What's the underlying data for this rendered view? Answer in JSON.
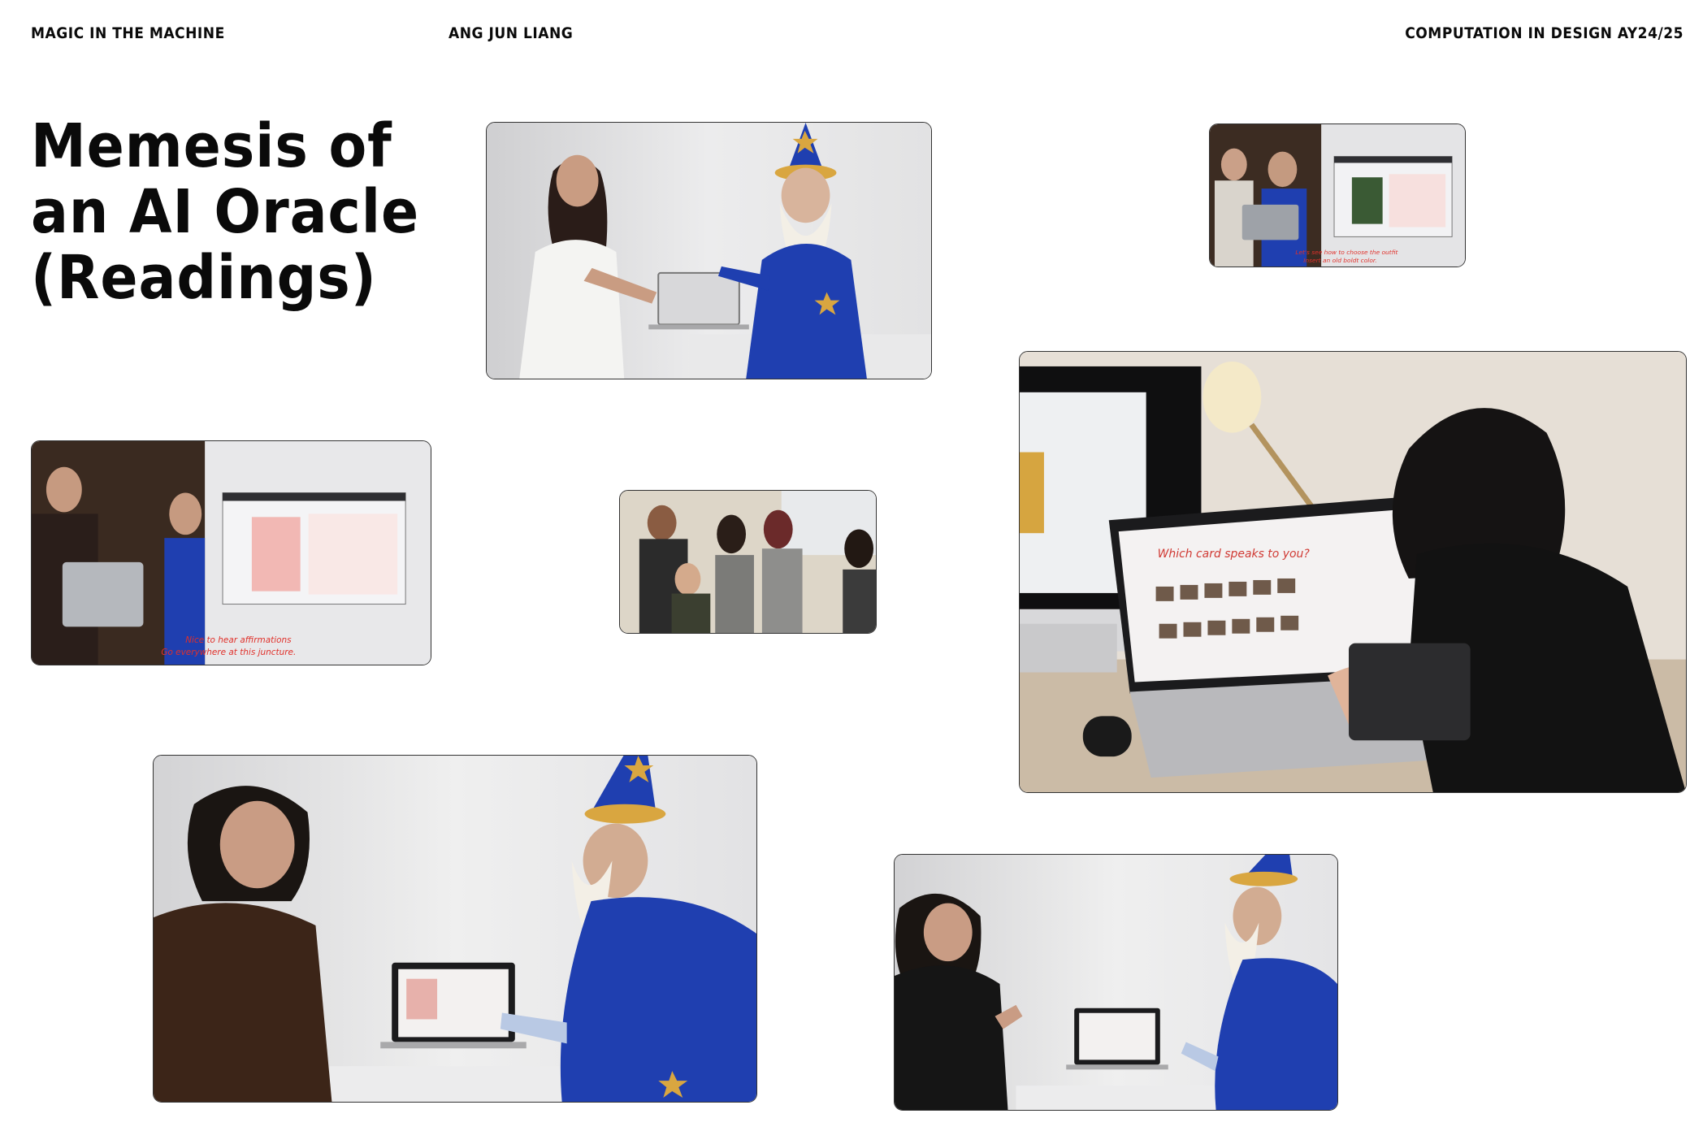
{
  "header": {
    "left": "MAGIC IN THE MACHINE",
    "center": "ANG JUN LIANG",
    "right": "COMPUTATION IN DESIGN AY24/25"
  },
  "title": {
    "line1": "Memesis of",
    "line2": "an AI Oracle",
    "line3": "(Readings)"
  },
  "photos": {
    "top_center": {
      "scene": "wizard-guiding-visitor-at-laptop"
    },
    "top_right": {
      "scene": "video-still-split-screen",
      "caption_line1": "Let's see how to choose the outfit",
      "caption_line2": "Insert an old boldt color."
    },
    "mid_left": {
      "scene": "video-still-split-screen",
      "caption_line1": "Nice to hear affirmations",
      "caption_line2": "Go everywhere at this juncture."
    },
    "mid_center": {
      "scene": "group-around-laptop"
    },
    "right_large": {
      "scene": "visitor-browsing-image-grid-on-laptop",
      "screen_headline": "Which card speaks to you?"
    },
    "bottom_left": {
      "scene": "wizard-and-visitor-laughing"
    },
    "bottom_right": {
      "scene": "wizard-and-visitor-reacting"
    }
  },
  "colors": {
    "wizard_blue": "#1f3fb0",
    "hat_star_gold": "#d9a640",
    "caption_red": "#e0302a"
  }
}
